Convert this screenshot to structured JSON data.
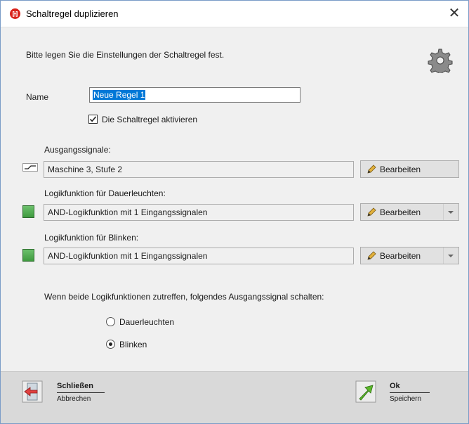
{
  "window": {
    "title": "Schaltregel duplizieren",
    "close_glyph": "✕",
    "title_icon": "app-logo-icon"
  },
  "intro_text": "Bitte legen Sie die Einstellungen der Schaltregel fest.",
  "name": {
    "label": "Name",
    "value": "Neue Regel 1"
  },
  "activate": {
    "label": "Die Schaltregel aktivieren",
    "checked": true
  },
  "output": {
    "label": "Ausgangssignale:",
    "value": "Maschine 3, Stufe 2",
    "button": "Bearbeiten"
  },
  "steady": {
    "label": "Logikfunktion für Dauerleuchten:",
    "value": "AND-Logikfunktion mit 1 Eingangssignalen",
    "button": "Bearbeiten"
  },
  "blink": {
    "label": "Logikfunktion für Blinken:",
    "value": "AND-Logikfunktion mit 1 Eingangssignalen",
    "button": "Bearbeiten"
  },
  "both_text": "Wenn beide Logikfunktionen zutreffen, folgendes Ausgangssignal schalten:",
  "options": [
    {
      "label": "Dauerleuchten",
      "selected": false
    },
    {
      "label": "Blinken",
      "selected": true
    }
  ],
  "footer": {
    "close_main": "Schließen",
    "close_sub": "Abbrechen",
    "ok_main": "Ok",
    "ok_sub": "Speichern"
  },
  "colors": {
    "accent_red": "#d9231b",
    "selection_blue": "#0078d7",
    "status_green": "#4aa84a"
  }
}
